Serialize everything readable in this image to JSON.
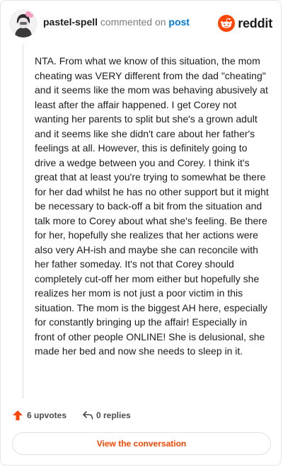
{
  "header": {
    "username": "pastel-spell",
    "commented_text": "commented on",
    "post_link": "post"
  },
  "brand": {
    "wordmark": "reddit",
    "icon": "reddit-alien-icon",
    "color": "#ff4500"
  },
  "comment": {
    "body": "NTA. From what we know of this situation, the mom cheating was VERY different from the dad \"cheating\" and it seems like the mom was behaving abusively at least after the affair happened. I get Corey not wanting her parents to split but she's a grown adult and it seems like she didn't care about her father's feelings at all. However, this is definitely going to drive a wedge between you and Corey. I think it's great that at least you're trying to somewhat be there for her dad whilst he has no other support but it might be necessary to back-off a bit from the situation and talk more to Corey about what she's feeling. Be there for her, hopefully she realizes that her actions were also very AH-ish and maybe she can reconcile with her father someday. It's not that Corey should completely cut-off her mom either but hopefully she realizes her mom is not just a poor victim in this situation. The mom is the biggest AH here, especially for constantly bringing up the affair! Especially in front of other people ONLINE! She is delusional, she made her bed and now she needs to sleep in it."
  },
  "actions": {
    "upvotes": "6 upvotes",
    "upvote_icon": "upvote-arrow-icon",
    "replies": "0 replies",
    "reply_icon": "reply-arrow-icon"
  },
  "footer": {
    "view_label": "View the conversation"
  },
  "colors": {
    "accent": "#ff4500",
    "link": "#0079d3",
    "text": "#1c1c1c",
    "muted": "#7c7c7c"
  }
}
